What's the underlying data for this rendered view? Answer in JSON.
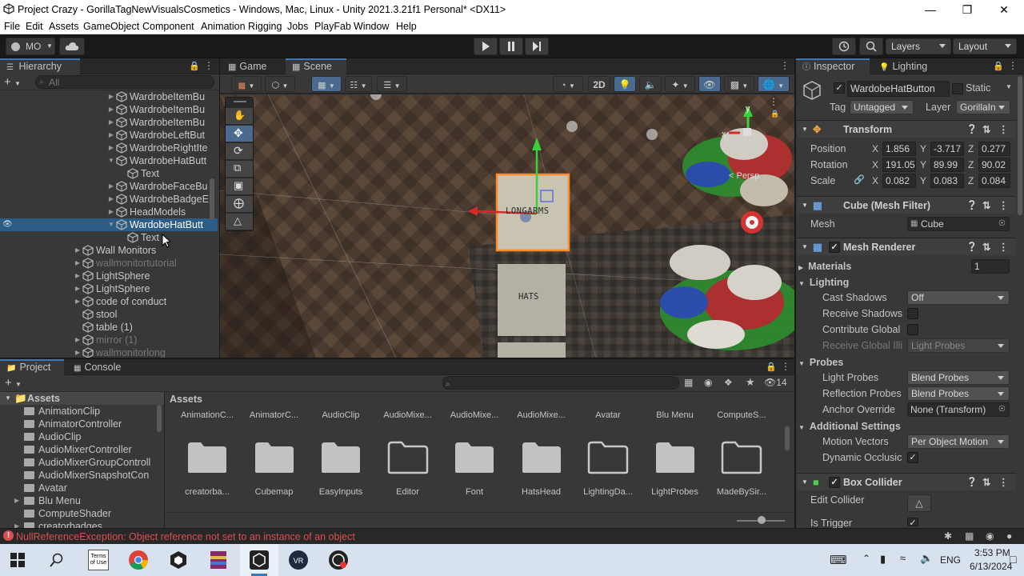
{
  "window": {
    "title": "Project Crazy - GorillaTagNewVisualsCosmetics - Windows, Mac, Linux - Unity 2021.3.21f1 Personal* <DX11>"
  },
  "menu": [
    "File",
    "Edit",
    "Assets",
    "GameObject",
    "Component",
    "Animation Rigging",
    "Jobs",
    "PlayFab",
    "Window",
    "Help"
  ],
  "toolbar": {
    "account": "MO",
    "layers": "Layers",
    "layout": "Layout"
  },
  "hierarchy": {
    "tab": "Hierarchy",
    "search_placeholder": "All",
    "rows": [
      {
        "label": "WardrobeItemBu",
        "indent": 134,
        "arrow": "▶",
        "state": ""
      },
      {
        "label": "WardrobeItemBu",
        "indent": 134,
        "arrow": "▶",
        "state": ""
      },
      {
        "label": "WardrobeItemBu",
        "indent": 134,
        "arrow": "▶",
        "state": ""
      },
      {
        "label": "WardrobeLeftBut",
        "indent": 134,
        "arrow": "▶",
        "state": ""
      },
      {
        "label": "WardrobeRightIte",
        "indent": 134,
        "arrow": "▶",
        "state": ""
      },
      {
        "label": "WardrobeHatButt",
        "indent": 134,
        "arrow": "▼",
        "state": ""
      },
      {
        "label": "Text",
        "indent": 148,
        "arrow": "",
        "state": ""
      },
      {
        "label": "WardrobeFaceBu",
        "indent": 134,
        "arrow": "▶",
        "state": ""
      },
      {
        "label": "WardrobeBadgeE",
        "indent": 134,
        "arrow": "▶",
        "state": ""
      },
      {
        "label": "HeadModels",
        "indent": 134,
        "arrow": "▶",
        "state": ""
      },
      {
        "label": "WardobeHatButt",
        "indent": 134,
        "arrow": "▼",
        "state": "sel"
      },
      {
        "label": "Text",
        "indent": 148,
        "arrow": "",
        "state": ""
      },
      {
        "label": "Wall Monitors",
        "indent": 92,
        "arrow": "▶",
        "state": ""
      },
      {
        "label": "wallmonitortutorial",
        "indent": 92,
        "arrow": "▶",
        "state": "dim"
      },
      {
        "label": "LightSphere",
        "indent": 92,
        "arrow": "▶",
        "state": ""
      },
      {
        "label": "LightSphere",
        "indent": 92,
        "arrow": "▶",
        "state": ""
      },
      {
        "label": "code of conduct",
        "indent": 92,
        "arrow": "▶",
        "state": ""
      },
      {
        "label": "stool",
        "indent": 92,
        "arrow": "",
        "state": ""
      },
      {
        "label": "table (1)",
        "indent": 92,
        "arrow": "",
        "state": ""
      },
      {
        "label": "mirror (1)",
        "indent": 92,
        "arrow": "▶",
        "state": "dim"
      },
      {
        "label": "wallmonitorlong",
        "indent": 92,
        "arrow": "▶",
        "state": "dim"
      }
    ]
  },
  "scene": {
    "tabs": [
      "Game",
      "Scene"
    ],
    "mode_2d": "2D",
    "persp": "< Persp",
    "axis_x": "x",
    "axis_y": "y",
    "label_longarms": "LONGARMS",
    "label_hats": "HATS"
  },
  "inspector": {
    "tabs": [
      "Inspector",
      "Lighting"
    ],
    "object_name": "WardobeHatButton",
    "static_label": "Static",
    "tag_label": "Tag",
    "tag_value": "Untagged",
    "layer_label": "Layer",
    "layer_value": "GorillaIn",
    "transform": {
      "title": "Transform",
      "position": {
        "label": "Position",
        "x": "1.856",
        "y": "-3.717",
        "z": "0.277"
      },
      "rotation": {
        "label": "Rotation",
        "x": "191.05",
        "y": "89.99",
        "z": "90.02"
      },
      "scale": {
        "label": "Scale",
        "x": "0.082",
        "y": "0.083",
        "z": "0.084"
      }
    },
    "mesh_filter": {
      "title": "Cube (Mesh Filter)",
      "mesh_label": "Mesh",
      "mesh_value": "Cube"
    },
    "mesh_renderer": {
      "title": "Mesh Renderer",
      "materials_label": "Materials",
      "materials_count": "1",
      "lighting_label": "Lighting",
      "cast_shadows_label": "Cast Shadows",
      "cast_shadows_value": "Off",
      "receive_shadows_label": "Receive Shadows",
      "contribute_gi_label": "Contribute Global",
      "receive_gi_label": "Receive Global Illi",
      "receive_gi_value": "Light Probes",
      "probes_label": "Probes",
      "light_probes_label": "Light Probes",
      "light_probes_value": "Blend Probes",
      "reflection_probes_label": "Reflection Probes",
      "reflection_probes_value": "Blend Probes",
      "anchor_override_label": "Anchor Override",
      "anchor_override_value": "None (Transform)",
      "additional_label": "Additional Settings",
      "motion_vectors_label": "Motion Vectors",
      "motion_vectors_value": "Per Object Motion",
      "dynamic_occlusion_label": "Dynamic Occlusic"
    },
    "box_collider": {
      "title": "Box Collider",
      "edit_collider_label": "Edit Collider",
      "is_trigger_label": "Is Trigger"
    }
  },
  "project": {
    "tabs": [
      "Project",
      "Console"
    ],
    "hidden_count": "14",
    "tree_root": "Assets",
    "tree": [
      "AnimationClip",
      "AnimatorController",
      "AudioClip",
      "AudioMixerController",
      "AudioMixerGroupControll",
      "AudioMixerSnapshotCon",
      "Avatar",
      "Blu Menu",
      "ComputeShader",
      "creatorbadges"
    ],
    "breadcrumb": "Assets",
    "top_labels": [
      "AnimationC...",
      "AnimatorC...",
      "AudioClip",
      "AudioMixe...",
      "AudioMixe...",
      "AudioMixe...",
      "Avatar",
      "Blu Menu",
      "ComputeS..."
    ],
    "folders": [
      "creatorba...",
      "Cubemap",
      "EasyInputs",
      "Editor",
      "Font",
      "HatsHead",
      "LightingDa...",
      "LightProbes",
      "MadeBySir..."
    ]
  },
  "status": {
    "error": "NullReferenceException: Object reference not set to an instance of an object"
  },
  "taskbar": {
    "lang": "ENG",
    "time": "3:53 PM",
    "date": "6/13/2024",
    "terms_icon": "Terms of Use"
  },
  "colors": {
    "accent": "#3a79bb",
    "selection": "#2c5d87",
    "error": "#d94f4f",
    "panel": "#383838"
  }
}
